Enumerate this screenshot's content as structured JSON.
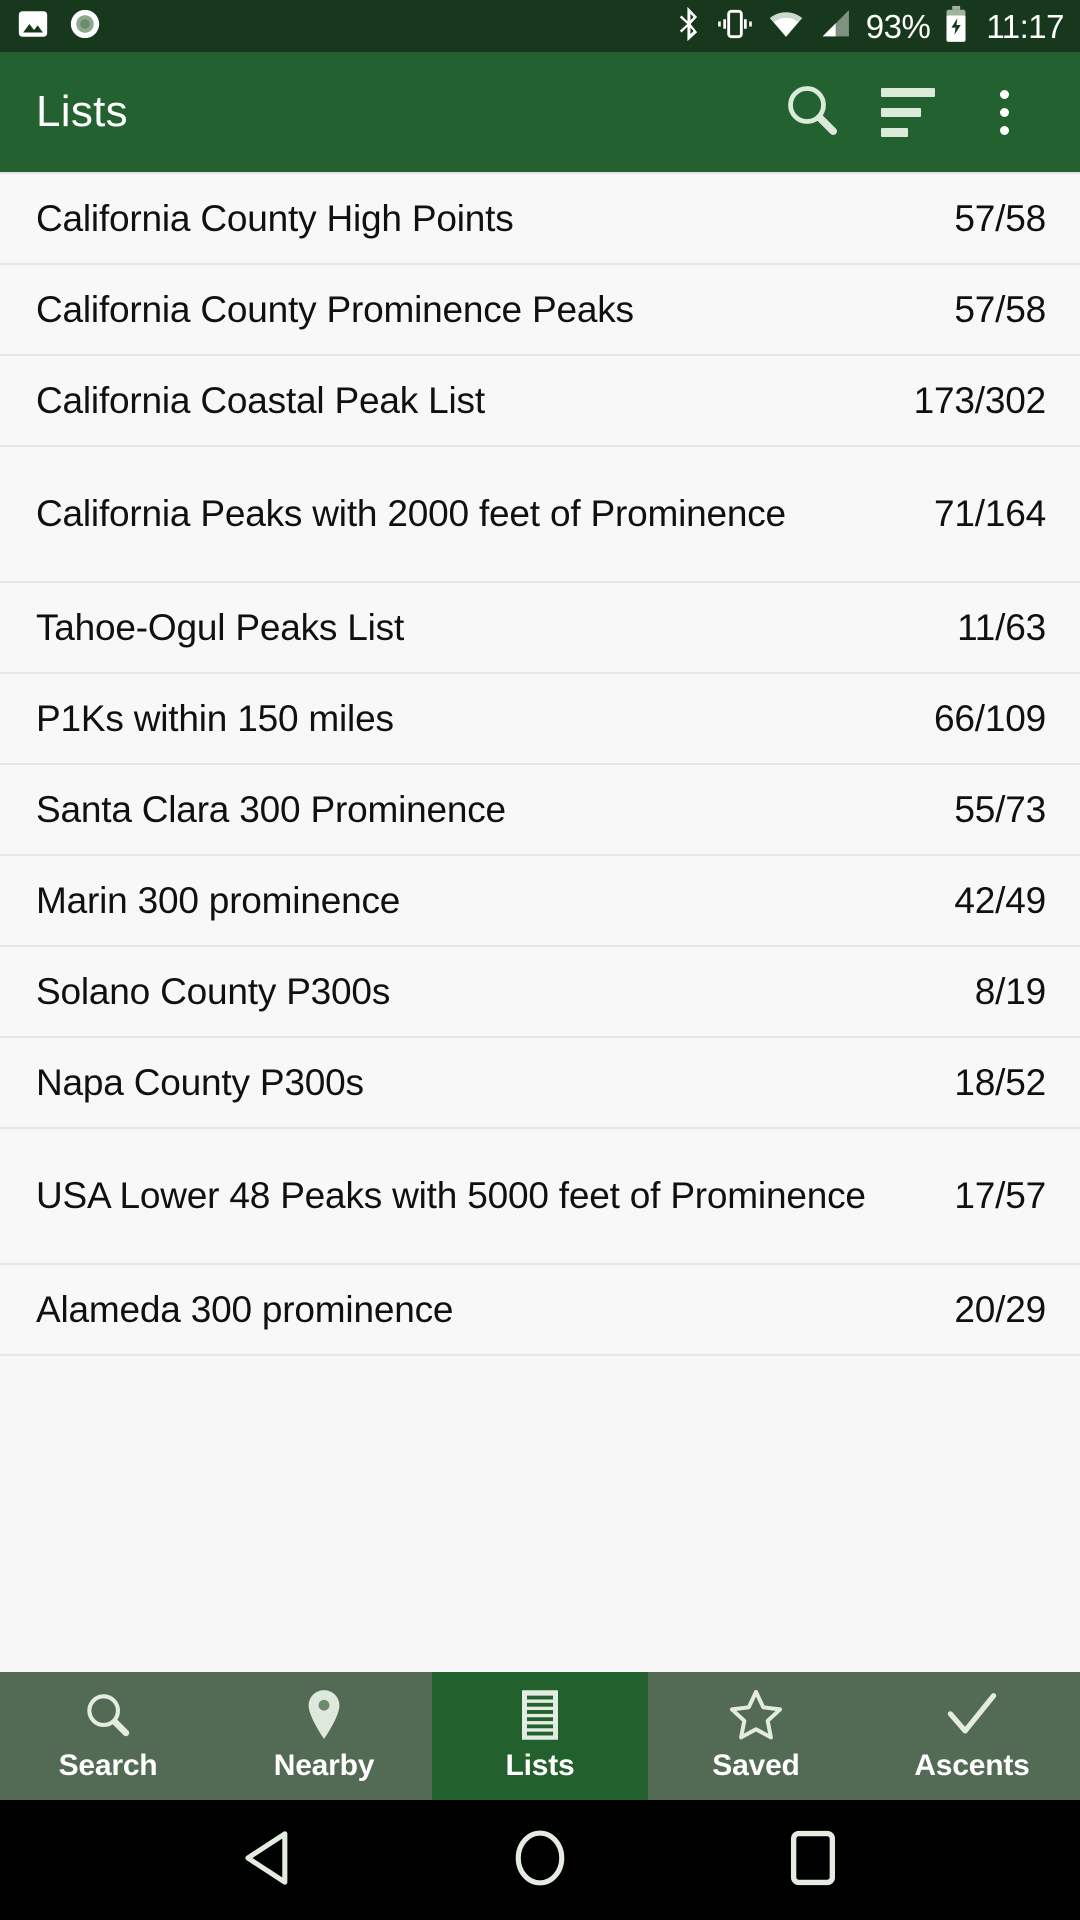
{
  "status_bar": {
    "left_icons": [
      "image-icon",
      "record-icon"
    ],
    "right_icons": [
      "bluetooth-icon",
      "vibrate-icon",
      "wifi-icon",
      "cellular-signal-icon",
      "battery-charging-icon"
    ],
    "battery_percent": "93%",
    "clock": "11:17",
    "background_color": "#18381d"
  },
  "app_bar": {
    "title": "Lists",
    "background_color": "#236130",
    "actions": [
      {
        "name": "search-button",
        "icon": "search-icon"
      },
      {
        "name": "sort-button",
        "icon": "sort-icon"
      },
      {
        "name": "overflow-menu-button",
        "icon": "more-vertical-icon"
      }
    ]
  },
  "lists": [
    {
      "name": "California County High Points",
      "count": "57/58",
      "two_line": false
    },
    {
      "name": "California County Prominence Peaks",
      "count": "57/58",
      "two_line": false
    },
    {
      "name": "California Coastal Peak List",
      "count": "173/302",
      "two_line": false
    },
    {
      "name": "California Peaks with 2000 feet of Prominence",
      "count": "71/164",
      "two_line": true
    },
    {
      "name": "Tahoe-Ogul Peaks List",
      "count": "11/63",
      "two_line": false
    },
    {
      "name": "P1Ks within 150 miles",
      "count": "66/109",
      "two_line": false
    },
    {
      "name": "Santa Clara 300 Prominence",
      "count": "55/73",
      "two_line": false
    },
    {
      "name": "Marin 300 prominence",
      "count": "42/49",
      "two_line": false
    },
    {
      "name": "Solano County P300s",
      "count": "8/19",
      "two_line": false
    },
    {
      "name": "Napa County P300s",
      "count": "18/52",
      "two_line": false
    },
    {
      "name": "USA Lower 48 Peaks with 5000 feet of Prominence",
      "count": "17/57",
      "two_line": true
    },
    {
      "name": "Alameda 300 prominence",
      "count": "20/29",
      "two_line": false
    }
  ],
  "bottom_nav": {
    "active_index": 2,
    "active_color": "#22602e",
    "inactive_color": "#536b54",
    "tabs": [
      {
        "label": "Search",
        "icon": "search-icon"
      },
      {
        "label": "Nearby",
        "icon": "map-pin-icon"
      },
      {
        "label": "Lists",
        "icon": "list-document-icon"
      },
      {
        "label": "Saved",
        "icon": "star-outline-icon"
      },
      {
        "label": "Ascents",
        "icon": "check-icon"
      }
    ]
  },
  "system_nav": {
    "buttons": [
      {
        "name": "back-button",
        "icon": "triangle-left-icon"
      },
      {
        "name": "home-button",
        "icon": "circle-icon"
      },
      {
        "name": "recents-button",
        "icon": "square-icon"
      }
    ]
  }
}
